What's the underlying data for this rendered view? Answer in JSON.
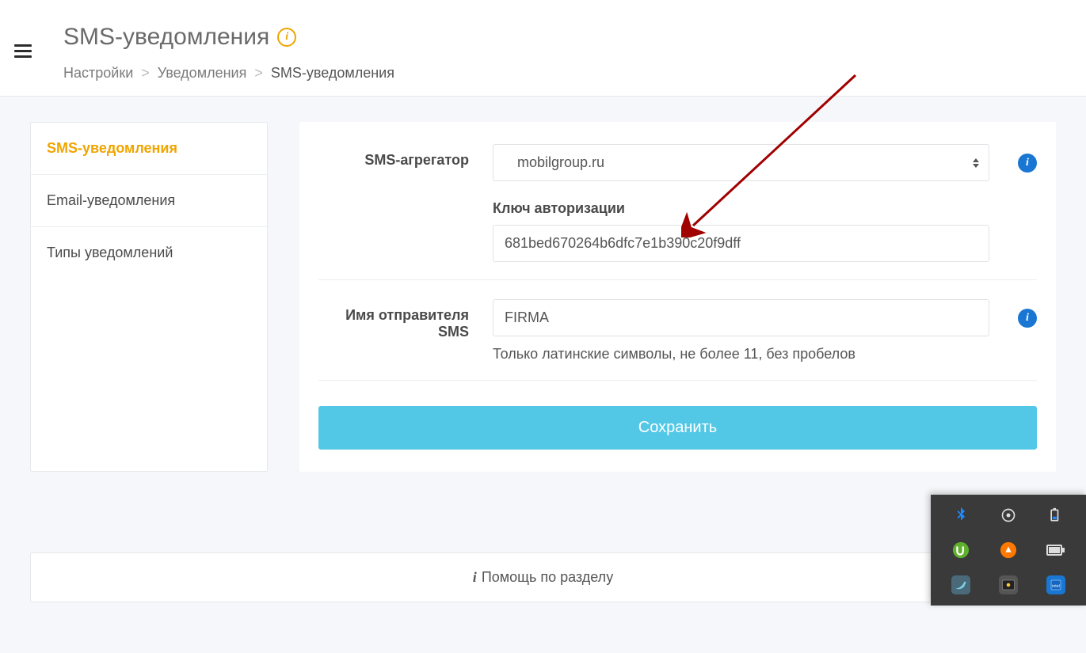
{
  "header": {
    "title": "SMS-уведомления"
  },
  "breadcrumb": {
    "item1": "Настройки",
    "item2": "Уведомления",
    "current": "SMS-уведомления"
  },
  "sidebar": {
    "items": [
      {
        "label": "SMS-уведомления"
      },
      {
        "label": "Email-уведомления"
      },
      {
        "label": "Типы уведомлений"
      }
    ]
  },
  "form": {
    "aggregator_label": "SMS-агрегатор",
    "aggregator_value": "mobilgroup.ru",
    "auth_key_label": "Ключ авторизации",
    "auth_key_value": "681bed670264b6dfc7e1b390c20f9dff",
    "sender_label": "Имя отправителя SMS",
    "sender_value": "FIRMA",
    "sender_hint": "Только латинские символы, не более 11, без пробелов",
    "save_label": "Сохранить"
  },
  "help": {
    "text": "Помощь по разделу"
  },
  "tray": {
    "icons": [
      "bluetooth-icon",
      "record-icon",
      "battery-icon",
      "utorrent-icon",
      "avast-icon",
      "power-icon",
      "bird-icon",
      "gallery-icon",
      "intel-icon"
    ]
  }
}
